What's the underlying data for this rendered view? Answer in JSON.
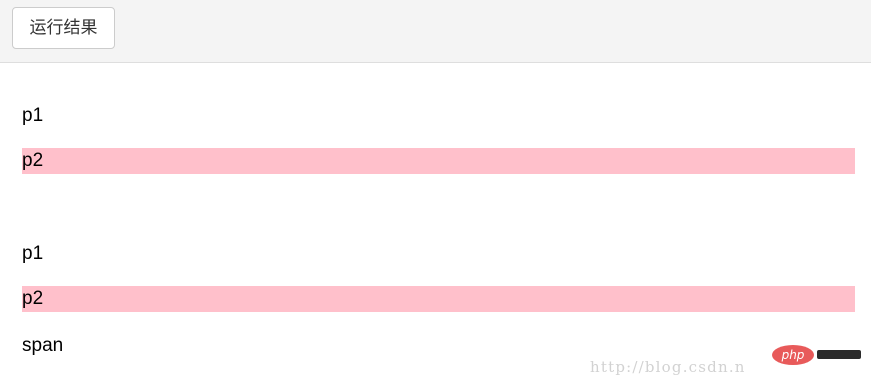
{
  "toolbar": {
    "run_button_label": "运行结果"
  },
  "result": {
    "paragraphs": [
      {
        "text": "p1",
        "highlight": false
      },
      {
        "text": "p2",
        "highlight": true
      },
      {
        "text": "p1",
        "highlight": false
      },
      {
        "text": "p2",
        "highlight": true
      },
      {
        "text": "span",
        "highlight": false
      }
    ]
  },
  "watermark": {
    "url_text": "http://blog.csdn.n",
    "logo_text": "php"
  },
  "colors": {
    "highlight": "#ffc0cb",
    "toolbar_bg": "#f4f4f4",
    "logo_bg": "#e85a5a"
  }
}
